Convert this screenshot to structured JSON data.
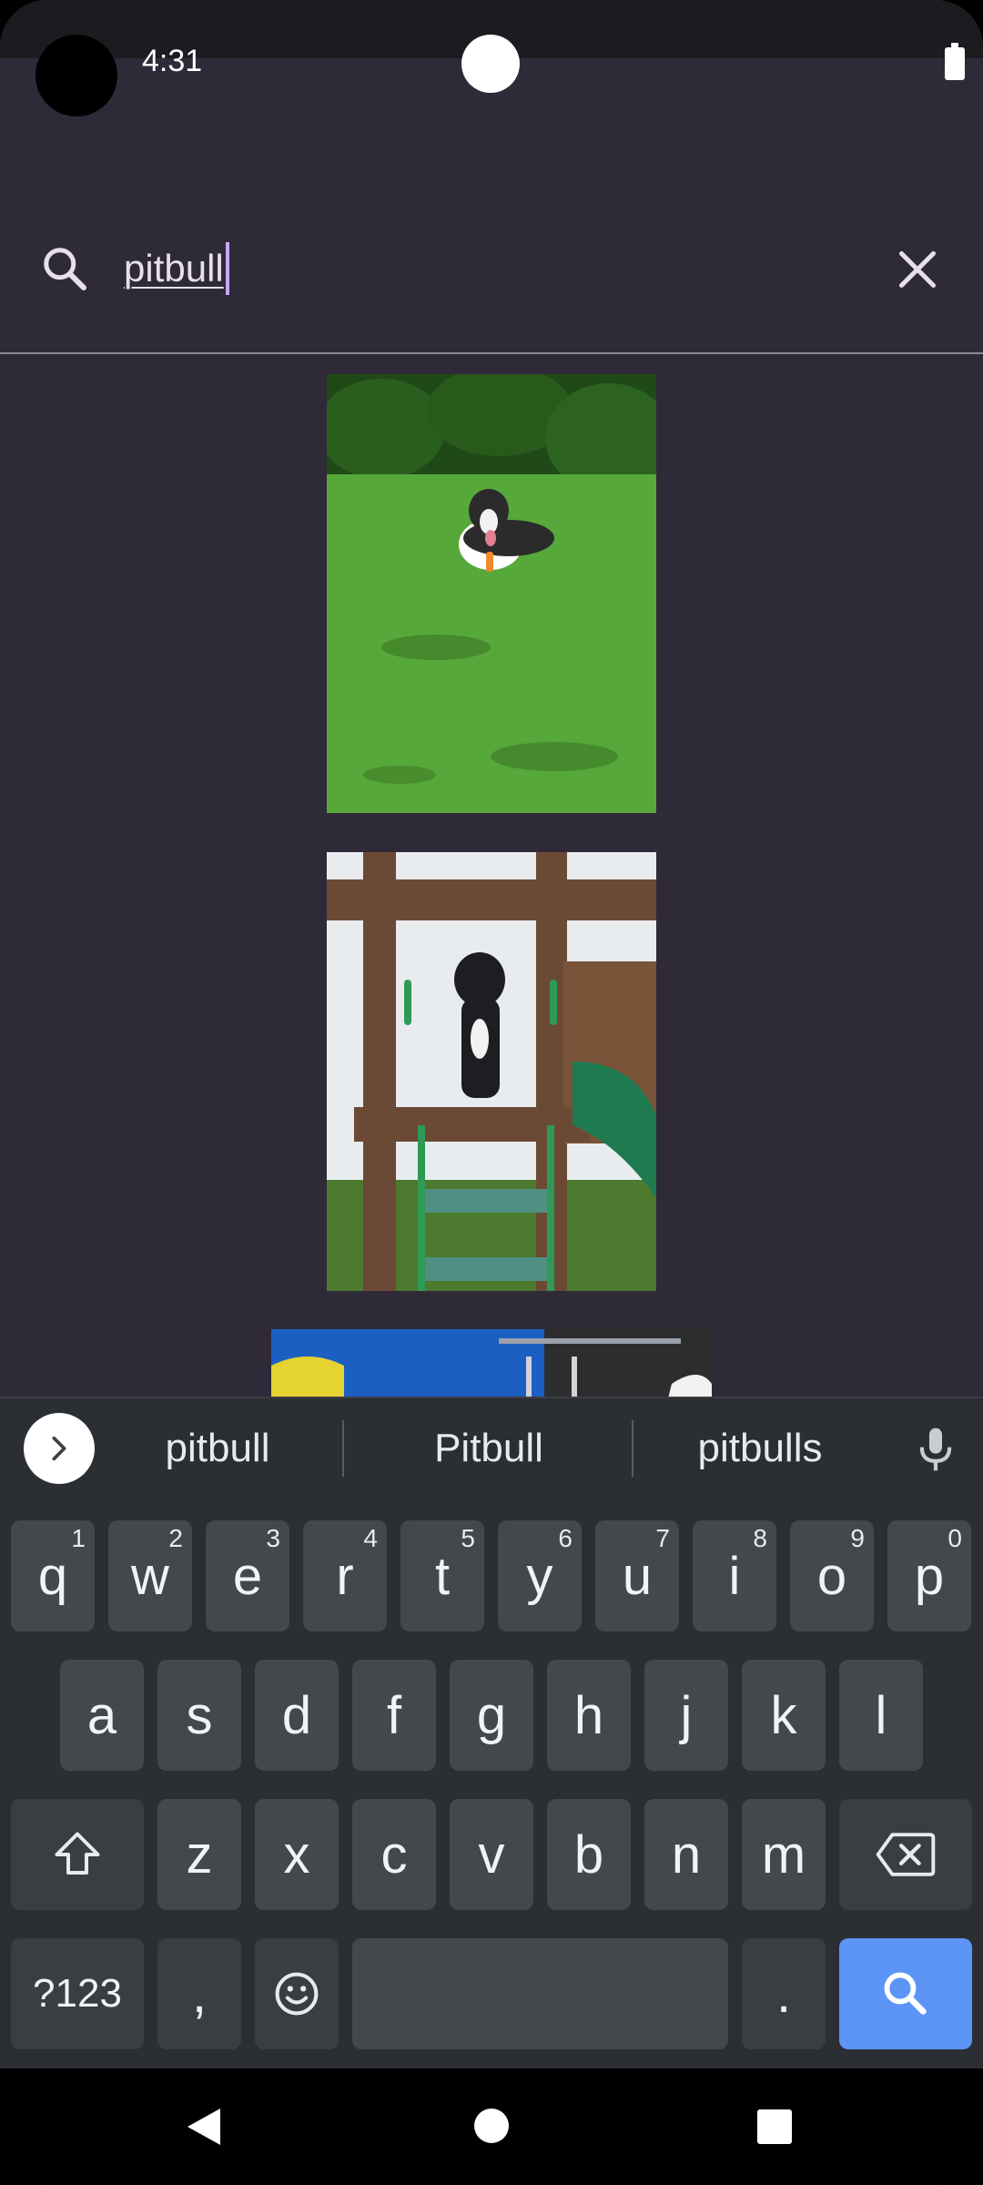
{
  "status_bar": {
    "time": "4:31"
  },
  "search": {
    "query": "pitbull",
    "search_icon": "search-icon",
    "clear_icon": "close-icon"
  },
  "results": {
    "images": [
      {
        "subject": "dog lying on grass"
      },
      {
        "subject": "dog on wooden playset"
      },
      {
        "subject": "swimming pool"
      }
    ]
  },
  "keyboard": {
    "suggestions": [
      "pitbull",
      "Pitbull",
      "pitbulls"
    ],
    "row1": [
      {
        "label": "q",
        "hint": "1"
      },
      {
        "label": "w",
        "hint": "2"
      },
      {
        "label": "e",
        "hint": "3"
      },
      {
        "label": "r",
        "hint": "4"
      },
      {
        "label": "t",
        "hint": "5"
      },
      {
        "label": "y",
        "hint": "6"
      },
      {
        "label": "u",
        "hint": "7"
      },
      {
        "label": "i",
        "hint": "8"
      },
      {
        "label": "o",
        "hint": "9"
      },
      {
        "label": "p",
        "hint": "0"
      }
    ],
    "row2": [
      "a",
      "s",
      "d",
      "f",
      "g",
      "h",
      "j",
      "k",
      "l"
    ],
    "row3": [
      "z",
      "x",
      "c",
      "v",
      "b",
      "n",
      "m"
    ],
    "symbols_label": "?123",
    "comma_label": ",",
    "period_label": ".",
    "accent_color": "#5c95f5"
  },
  "colors": {
    "background": "#2f2a38",
    "caret": "#c7a6ff",
    "keyboard_bg": "#2b2e33",
    "key_bg": "#44474c"
  }
}
